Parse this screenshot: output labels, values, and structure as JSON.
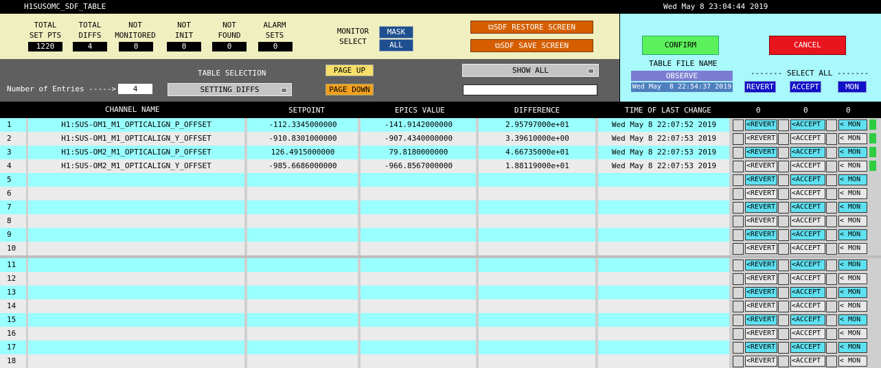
{
  "window": {
    "title": "H1SUSOMC_SDF_TABLE",
    "clock": "Wed May  8 23:04:44 2019"
  },
  "stats": [
    {
      "label": "TOTAL\nSET PTS",
      "value": "1220"
    },
    {
      "label": "TOTAL\nDIFFS",
      "value": "4"
    },
    {
      "label": "NOT\nMONITORED",
      "value": "0"
    },
    {
      "label": "NOT\nINIT",
      "value": "0"
    },
    {
      "label": "NOT\nFOUND",
      "value": "0"
    },
    {
      "label": "ALARM\nSETS",
      "value": "0"
    }
  ],
  "monitor": {
    "label": "MONITOR\nSELECT",
    "mask": "MASK",
    "all": "ALL"
  },
  "screens": {
    "restore": "SDF RESTORE SCREEN",
    "save": "SDF SAVE SCREEN"
  },
  "table_selection": {
    "label": "TABLE SELECTION",
    "selected": "SETTING DIFFS",
    "entries_label": "Number of Entries ----->",
    "entries_value": "4",
    "page_up": "PAGE UP",
    "page_down": "PAGE DOWN",
    "show": "SHOW ALL",
    "filter": ""
  },
  "right_panel": {
    "confirm": "CONFIRM",
    "cancel": "CANCEL",
    "table_file_label": "TABLE FILE NAME",
    "table_file": "OBSERVE",
    "table_time": "Wed May  8 22:54:37 2019",
    "select_all_label": "------- SELECT ALL -------",
    "revert": "REVERT",
    "accept": "ACCEPT",
    "mon": "MON"
  },
  "columns": {
    "channel": "CHANNEL NAME",
    "setpoint": "SETPOINT",
    "epics": "EPICS VALUE",
    "difference": "DIFFERENCE",
    "time": "TIME OF LAST CHANGE",
    "c1": "0",
    "c2": "0",
    "c3": "0"
  },
  "row_buttons": {
    "revert": "<REVERT",
    "accept": "<ACCEPT",
    "mon": "< MON"
  },
  "rows": [
    {
      "n": "1",
      "channel": "H1:SUS-OM1_M1_OPTICALIGN_P_OFFSET",
      "setpoint": "-112.3345000000",
      "epics": "-141.9142000000",
      "diff": "2.95797000e+01",
      "time": "Wed May  8 22:07:52 2019"
    },
    {
      "n": "2",
      "channel": "H1:SUS-OM1_M1_OPTICALIGN_Y_OFFSET",
      "setpoint": "-910.8301000000",
      "epics": "-907.4340000000",
      "diff": "3.39610000e+00",
      "time": "Wed May  8 22:07:53 2019"
    },
    {
      "n": "3",
      "channel": "H1:SUS-OM2_M1_OPTICALIGN_P_OFFSET",
      "setpoint": "126.4915000000",
      "epics": "79.8180000000",
      "diff": "4.66735000e+01",
      "time": "Wed May  8 22:07:53 2019"
    },
    {
      "n": "4",
      "channel": "H1:SUS-OM2_M1_OPTICALIGN_Y_OFFSET",
      "setpoint": "-985.6686000000",
      "epics": "-966.8567000000",
      "diff": "1.88119000e+01",
      "time": "Wed May  8 22:07:53 2019"
    },
    {
      "n": "5",
      "channel": "",
      "setpoint": "",
      "epics": "",
      "diff": "",
      "time": ""
    },
    {
      "n": "6",
      "channel": "",
      "setpoint": "",
      "epics": "",
      "diff": "",
      "time": ""
    },
    {
      "n": "7",
      "channel": "",
      "setpoint": "",
      "epics": "",
      "diff": "",
      "time": ""
    },
    {
      "n": "8",
      "channel": "",
      "setpoint": "",
      "epics": "",
      "diff": "",
      "time": ""
    },
    {
      "n": "9",
      "channel": "",
      "setpoint": "",
      "epics": "",
      "diff": "",
      "time": ""
    },
    {
      "n": "10",
      "channel": "",
      "setpoint": "",
      "epics": "",
      "diff": "",
      "time": ""
    },
    {
      "n": "11",
      "channel": "",
      "setpoint": "",
      "epics": "",
      "diff": "",
      "time": ""
    },
    {
      "n": "12",
      "channel": "",
      "setpoint": "",
      "epics": "",
      "diff": "",
      "time": ""
    },
    {
      "n": "13",
      "channel": "",
      "setpoint": "",
      "epics": "",
      "diff": "",
      "time": ""
    },
    {
      "n": "14",
      "channel": "",
      "setpoint": "",
      "epics": "",
      "diff": "",
      "time": ""
    },
    {
      "n": "15",
      "channel": "",
      "setpoint": "",
      "epics": "",
      "diff": "",
      "time": ""
    },
    {
      "n": "16",
      "channel": "",
      "setpoint": "",
      "epics": "",
      "diff": "",
      "time": ""
    },
    {
      "n": "17",
      "channel": "",
      "setpoint": "",
      "epics": "",
      "diff": "",
      "time": ""
    },
    {
      "n": "18",
      "channel": "",
      "setpoint": "",
      "epics": "",
      "diff": "",
      "time": ""
    }
  ],
  "colors": {
    "row_cyan": "#99ffff",
    "row_gray": "#ebebeb",
    "active_green": "#2ecc40",
    "confirm_green": "#5cf05c",
    "cancel_red": "#e8141e"
  }
}
